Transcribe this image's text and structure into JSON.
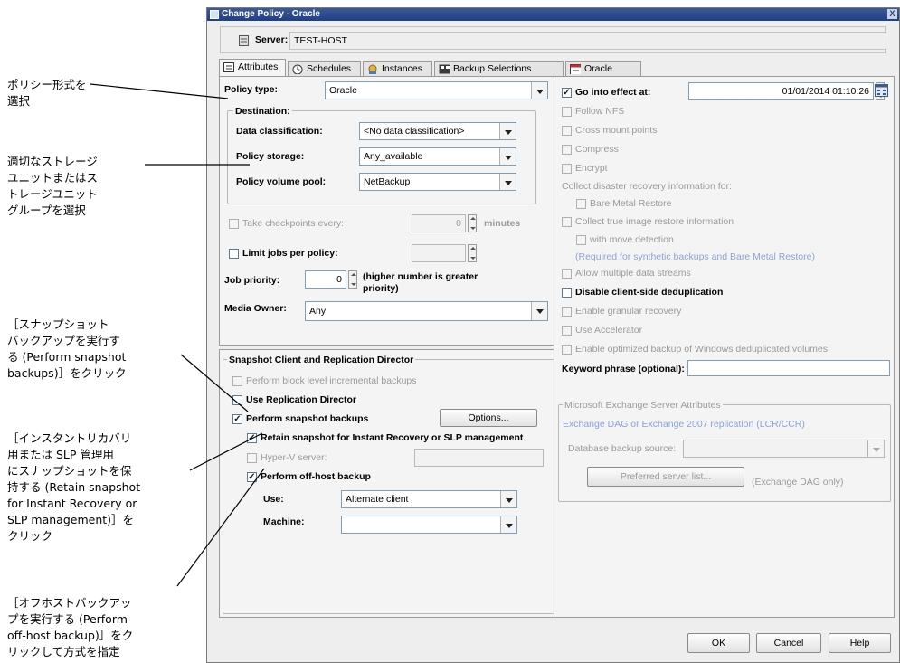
{
  "annotations": {
    "policy_type": "ポリシー形式を\n選択",
    "storage": "適切なストレージ\nユニットまたはス\nトレージユニット\nグループを選択",
    "snapshot": "［スナップショット\nバックアップを実行す\nる (Perform snapshot\nbackups)］をクリック",
    "retain": "［インスタントリカバリ\n用または SLP 管理用\nにスナップショットを保\n持する (Retain snapshot\nfor Instant Recovery or\nSLP management)］を\nクリック",
    "offhost": "［オフホストバックアッ\nプを実行する (Perform\noff-host backup)］をク\nリックして方式を指定"
  },
  "window": {
    "title": "Change Policy - Oracle",
    "close": "X"
  },
  "server": {
    "label": "Server:",
    "value": "TEST-HOST"
  },
  "tabs": [
    "Attributes",
    "Schedules",
    "Instances",
    "Backup Selections",
    "Oracle"
  ],
  "left": {
    "policy_type_label": "Policy type:",
    "policy_type_value": "Oracle",
    "destination_label": "Destination:",
    "data_class_label": "Data classification:",
    "data_class_value": "<No data classification>",
    "policy_storage_label": "Policy storage:",
    "policy_storage_value": "Any_available",
    "volume_pool_label": "Policy volume pool:",
    "volume_pool_value": "NetBackup",
    "checkpoints_label": "Take checkpoints every:",
    "checkpoints_value": "0",
    "checkpoints_unit": "minutes",
    "limit_jobs_label": "Limit jobs per policy:",
    "job_priority_label": "Job priority:",
    "job_priority_value": "0",
    "job_priority_note": "(higher number is greater\npriority)",
    "media_owner_label": "Media Owner:",
    "media_owner_value": "Any"
  },
  "snapshot": {
    "group_label": "Snapshot Client and Replication Director",
    "block_level": "Perform block level incremental backups",
    "replication_director": "Use Replication Director",
    "perform_snapshot": "Perform snapshot backups",
    "options_button": "Options...",
    "retain_snapshot": "Retain snapshot for Instant Recovery or SLP management",
    "hyperv_label": "Hyper-V server:",
    "offhost": "Perform off-host backup",
    "use_label": "Use:",
    "use_value": "Alternate client",
    "machine_label": "Machine:",
    "machine_value": ""
  },
  "right": {
    "go_into_effect": "Go into effect at:",
    "go_into_effect_value": "01/01/2014 01:10:26",
    "follow_nfs": "Follow NFS",
    "cross_mount": "Cross mount points",
    "compress": "Compress",
    "encrypt": "Encrypt",
    "disaster_label": "Collect disaster recovery information for:",
    "bare_metal": "Bare Metal Restore",
    "true_image": "Collect true image restore information",
    "move_detection": "with move detection",
    "required_note": "(Required for synthetic backups and Bare Metal Restore)",
    "multiple_streams": "Allow multiple data streams",
    "disable_dedup": "Disable client-side deduplication",
    "granular": "Enable granular recovery",
    "accelerator": "Use Accelerator",
    "optimized": "Enable optimized backup of Windows deduplicated volumes",
    "keyword_label": "Keyword phrase (optional):",
    "keyword_value": ""
  },
  "exchange": {
    "group_label": "Microsoft Exchange Server Attributes",
    "dag": "Exchange DAG or Exchange 2007 replication (LCR/CCR)",
    "db_source_label": "Database backup source:",
    "preferred_button": "Preferred server list...",
    "dag_only": "(Exchange DAG only)"
  },
  "buttons": {
    "ok": "OK",
    "cancel": "Cancel",
    "help": "Help"
  },
  "colors": {
    "title_bar": "#1f3f86",
    "disabled_text": "#9a9a9a",
    "note_blue": "#8aa4d8"
  }
}
